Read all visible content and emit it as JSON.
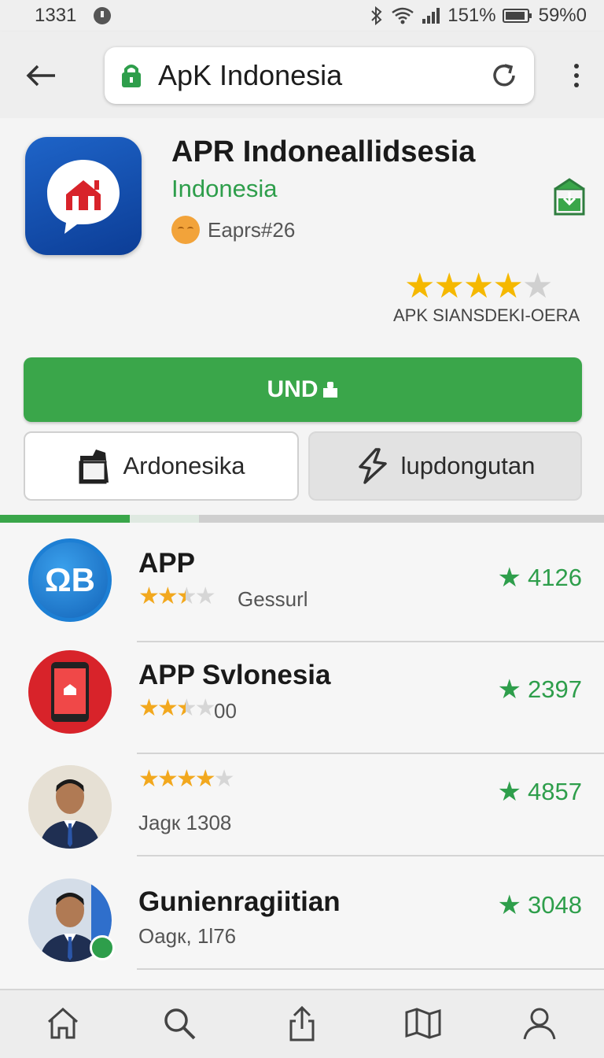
{
  "status": {
    "time": "1331",
    "battery_text": "151%",
    "signal_text": "59%0"
  },
  "toolbar": {
    "url": "ApK Indonesia"
  },
  "app": {
    "title": "APR Indoneallidsesia",
    "developer": "Indonesia",
    "meta": "Eaprs#26",
    "rating_stars": 4,
    "rating_max": 5,
    "rating_label": "APK SIANSDEKI-OERA",
    "install_label": "UND",
    "action_left_label": "Ardonesika",
    "action_right_label": "lupdongutan"
  },
  "list": [
    {
      "title": "APP",
      "sub": "Gessurl",
      "stars": 2.5,
      "count": "4126",
      "icon": "ab-logo-icon",
      "icon_text": "ΩB"
    },
    {
      "title": "APP Svlonesia",
      "sub": "00",
      "stars": 2.5,
      "count": "2397",
      "icon": "phone-app-icon"
    },
    {
      "title": "",
      "sub": "Jagк 1308",
      "stars": 4,
      "count": "4857",
      "icon": "person-avatar"
    },
    {
      "title": "Gunienragiitian",
      "sub": "Oagк, 1l76",
      "stars": 0,
      "count": "3048",
      "icon": "person-avatar-online"
    }
  ],
  "colors": {
    "accent_green": "#3aa64a",
    "star_yellow": "#f5b800",
    "icon_blue": "#1e64c8",
    "icon_red": "#d8232a"
  }
}
